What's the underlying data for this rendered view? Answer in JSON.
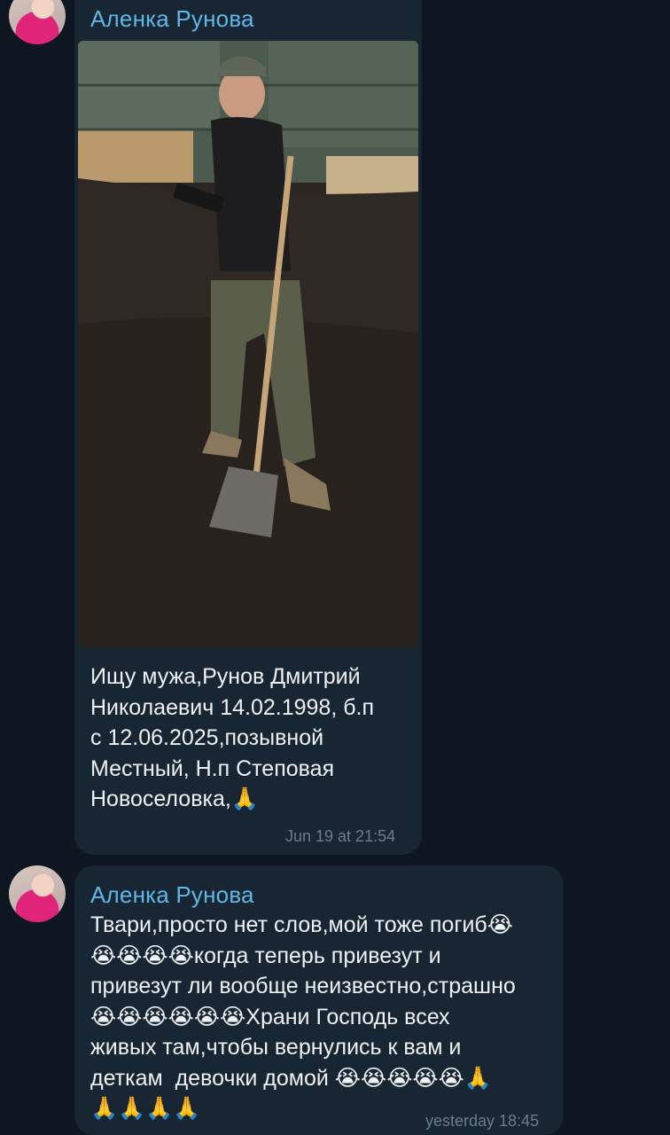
{
  "messages": [
    {
      "sender": "Аленка Рунова",
      "text": "Ищу мужа,Рунов Дмитрий\nНиколаевич 14.02.1998, б.п\nс 12.06.2025,позывной\nМестный, Н.п Степовая\nНовоселовка,🙏",
      "time": "Jun 19 at 21:54",
      "has_photo": true
    },
    {
      "sender": "Аленка Рунова",
      "text": "Твари,просто нет слов,мой тоже погиб😭\n😭😭😭😭когда теперь привезут и\nпривезут ли вообще неизвестно,страшно\n😭😭😭😭😭😭Храни Господь всех\nживых там,чтобы вернулись к вам и\nдеткам  девочки домой 😭😭😭😭😭🙏\n🙏🙏🙏🙏",
      "time": "yesterday 18:45",
      "has_photo": false
    }
  ],
  "colors": {
    "background": "#0e1621",
    "bubble": "#182533",
    "sender_name": "#5fb7e6",
    "text": "#eef2f5",
    "timestamp": "#6b7c8d"
  }
}
